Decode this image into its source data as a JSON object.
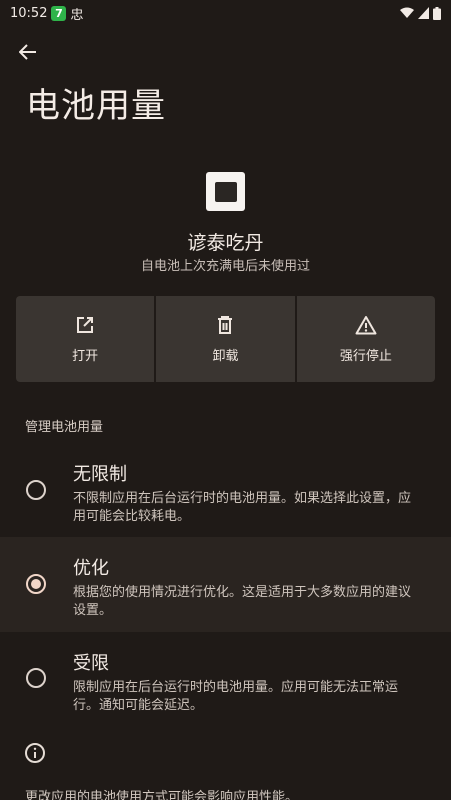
{
  "status_bar": {
    "time": "10:52",
    "badge": "7",
    "extra_glyph": "忠"
  },
  "header": {
    "title": "电池用量"
  },
  "app": {
    "name": "谚泰吃丹",
    "subtitle": "自电池上次充满电后未使用过"
  },
  "actions": [
    {
      "label": "打开",
      "icon": "open-external-icon"
    },
    {
      "label": "卸载",
      "icon": "trash-icon"
    },
    {
      "label": "强行停止",
      "icon": "warning-icon"
    }
  ],
  "section": {
    "label": "管理电池用量"
  },
  "options": [
    {
      "title": "无限制",
      "desc": "不限制应用在后台运行时的电池用量。如果选择此设置，应用可能会比较耗电。",
      "selected": false
    },
    {
      "title": "优化",
      "desc": "根据您的使用情况进行优化。这是适用于大多数应用的建议设置。",
      "selected": true
    },
    {
      "title": "受限",
      "desc": "限制应用在后台运行时的电池用量。应用可能无法正常运行。通知可能会延迟。",
      "selected": false
    }
  ],
  "footer": {
    "text": "更改应用的电池使用方式可能会影响应用性能。"
  },
  "colors": {
    "background": "#1f1a17",
    "button_bg": "#3a3531",
    "accent": "#f1d6c8"
  }
}
